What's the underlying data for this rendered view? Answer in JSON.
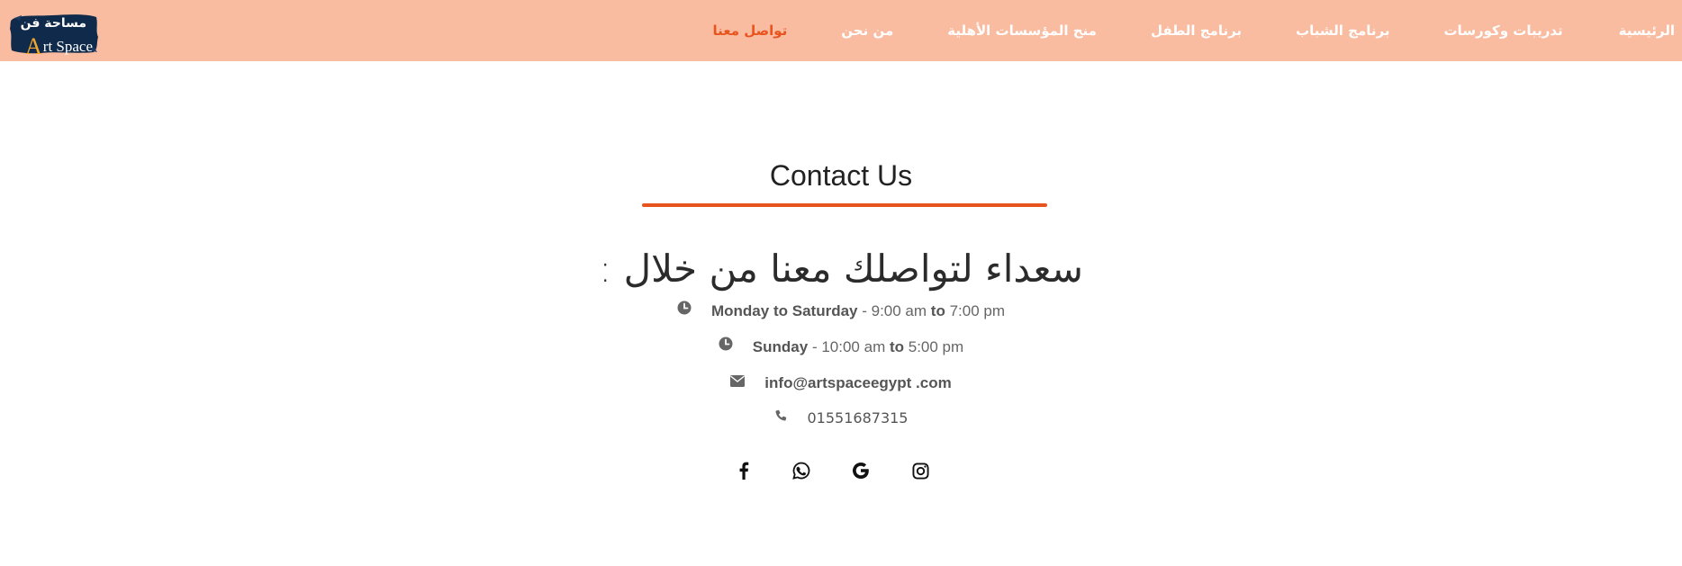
{
  "brand": {
    "logo_arabic": "مساحة فن",
    "logo_english_cap": "A",
    "logo_english_rest": "rt Space"
  },
  "nav": {
    "items": [
      {
        "label": "الرئيسية",
        "active": false
      },
      {
        "label": "تدريبات وكورسات",
        "active": false
      },
      {
        "label": "برنامج الشباب",
        "active": false
      },
      {
        "label": "برنامج الطفل",
        "active": false
      },
      {
        "label": "منح المؤسسات الأهلية",
        "active": false
      },
      {
        "label": "من نحن",
        "active": false
      },
      {
        "label": "تواصل معنا",
        "active": true
      }
    ]
  },
  "contact": {
    "title": "Contact Us",
    "heading": "سعداء لتواصلك معنا من خلال :",
    "hours_weekdays": {
      "days": "Monday",
      "to1": "to",
      "days2": "Saturday",
      "sep": "-",
      "from": "9:00 am",
      "to2": "to",
      "until": "7:00 pm"
    },
    "hours_sunday": {
      "days": "Sunday",
      "sep": "-",
      "from": "10:00 am",
      "to": "to",
      "until": "5:00 pm"
    },
    "email": "info@artspaceegypt .com",
    "phone": "01551687315"
  },
  "colors": {
    "navbar_bg": "#f9bca1",
    "accent": "#e8541e",
    "logo_bg": "#0f2a4a"
  },
  "icons": {
    "hours": "clock-icon",
    "email": "envelope-icon",
    "phone": "phone-icon",
    "socials": [
      "facebook-icon",
      "whatsapp-icon",
      "google-icon",
      "instagram-icon"
    ]
  }
}
